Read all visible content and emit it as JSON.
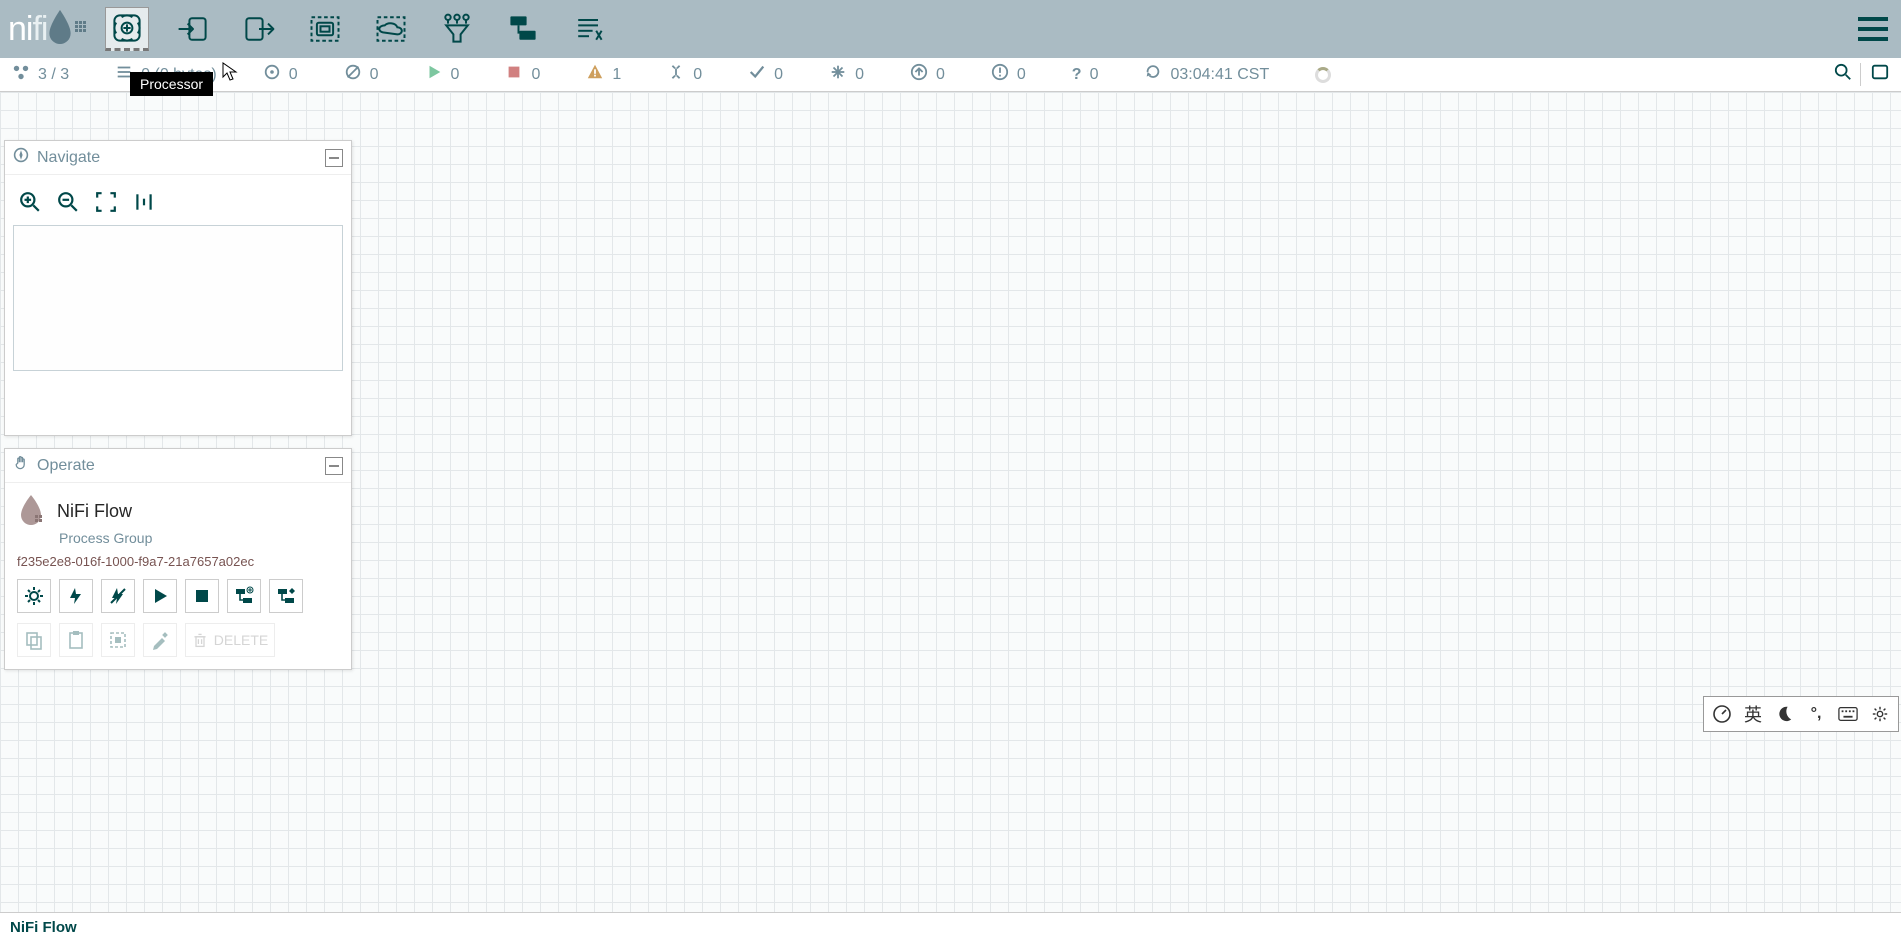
{
  "app": {
    "name": "nifi"
  },
  "toolbar": {
    "tooltip": "Processor",
    "items": [
      {
        "name": "processor",
        "active": true
      },
      {
        "name": "input-port"
      },
      {
        "name": "output-port"
      },
      {
        "name": "process-group"
      },
      {
        "name": "remote-process-group"
      },
      {
        "name": "funnel"
      },
      {
        "name": "template"
      },
      {
        "name": "label"
      }
    ]
  },
  "status": {
    "nodes": "3 / 3",
    "queued": "0 (0 bytes)",
    "transmitting": "0",
    "not_transmitting": "0",
    "running": "0",
    "stopped": "0",
    "invalid": "1",
    "disabled": "0",
    "up_to_date": "0",
    "locally_modified": "0",
    "stale": "0",
    "sync_failures": "0",
    "unknown": "0",
    "time": "03:04:41 CST"
  },
  "panels": {
    "navigate": {
      "title": "Navigate"
    },
    "operate": {
      "title": "Operate",
      "flow_name": "NiFi Flow",
      "flow_type": "Process Group",
      "flow_id": "f235e2e8-016f-1000-f9a7-21a7657a02ec",
      "delete_label": "DELETE"
    }
  },
  "ime": {
    "lang": "英"
  },
  "breadcrumb": {
    "path": "NiFi Flow"
  }
}
